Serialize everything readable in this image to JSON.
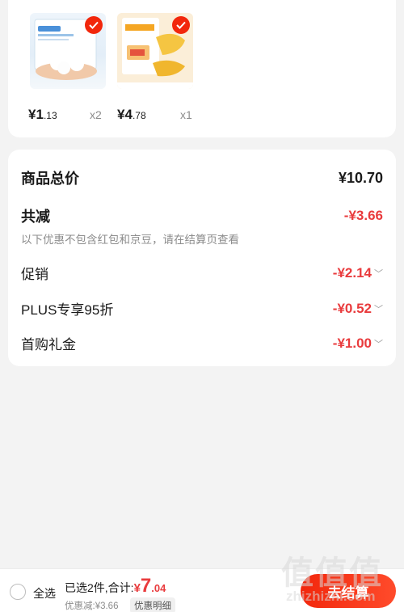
{
  "products": [
    {
      "yen": "¥",
      "main": "1",
      "cents": ".13",
      "qty": "x2"
    },
    {
      "yen": "¥",
      "main": "4",
      "cents": ".78",
      "qty": "x1"
    }
  ],
  "summary": {
    "total_label": "商品总价",
    "total_value": "¥10.70",
    "reduce_label": "共减",
    "reduce_value": "-¥3.66",
    "note": "以下优惠不包含红包和京豆，请在结算页查看",
    "promo_label": "促销",
    "promo_value": "-¥2.14",
    "plus_label": "PLUS专享95折",
    "plus_value": "-¥0.52",
    "gift_label": "首购礼金",
    "gift_value": "-¥1.00"
  },
  "bottom": {
    "select_all": "全选",
    "selected_text": "已选2件,合计:",
    "yen": "¥",
    "amount_big": "7",
    "amount_small": ".04",
    "saved": "优惠减:¥3.66",
    "detail_button": "优惠明细",
    "checkout": "去结算"
  },
  "watermark": {
    "glyphs": "值值值",
    "url": "zhizhizhi.com"
  },
  "colors": {
    "accent": "#f2270c",
    "price_red": "#e93b3d"
  }
}
